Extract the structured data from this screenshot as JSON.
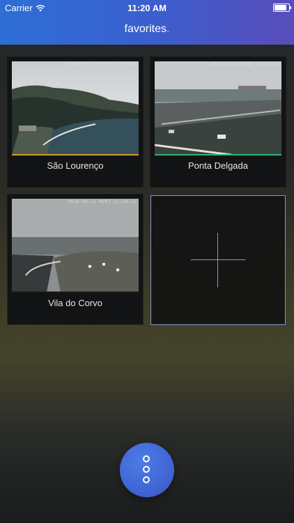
{
  "status_bar": {
    "carrier": "Carrier",
    "time": "11:20 AM",
    "battery_level": 0.95
  },
  "header": {
    "title": "favorites",
    "title_suffix": "."
  },
  "favorites": [
    {
      "name": "São  Lourenço",
      "timestamp": "2016-03-11 M207 11:20:08",
      "accent_color": "#d1a12c"
    },
    {
      "name": "Ponta Delgada",
      "timestamp": "2016-03-11 M207 11:20:10",
      "accent_color": "#2fb36b"
    },
    {
      "name": "Vila do Corvo",
      "timestamp": "2016-03-11 M207 11:20:11",
      "accent_color": "#1a1a1a"
    }
  ],
  "add_tile": {
    "icon": "plus-icon"
  },
  "fab": {
    "icon": "more-vertical-icon",
    "color": "#3f63d6"
  }
}
